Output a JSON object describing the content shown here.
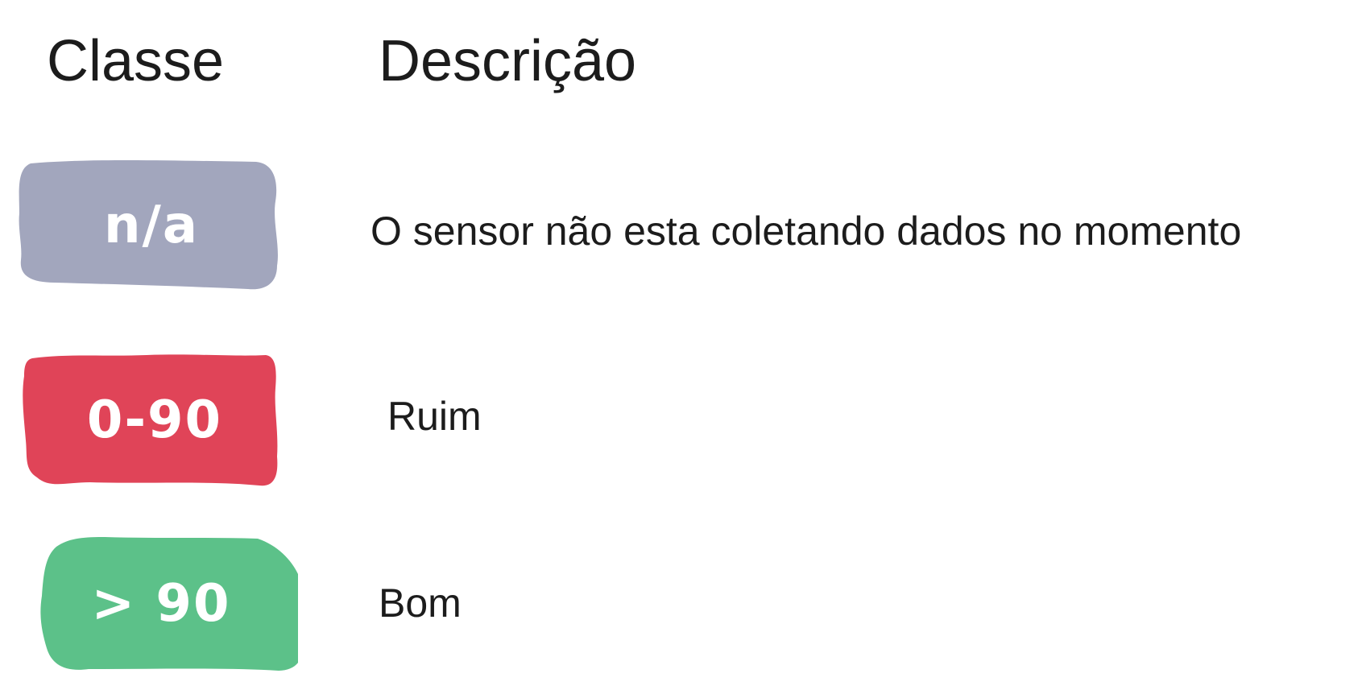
{
  "headers": {
    "class": "Classe",
    "description": "Descrição"
  },
  "rows": [
    {
      "badge": "n/a",
      "description": "O sensor não esta coletando dados no momento",
      "color": "#a2a6bd"
    },
    {
      "badge": "0-90",
      "description": "Ruim",
      "color": "#e04458"
    },
    {
      "badge": "> 90",
      "description": "Bom",
      "color": "#5cc189"
    }
  ]
}
